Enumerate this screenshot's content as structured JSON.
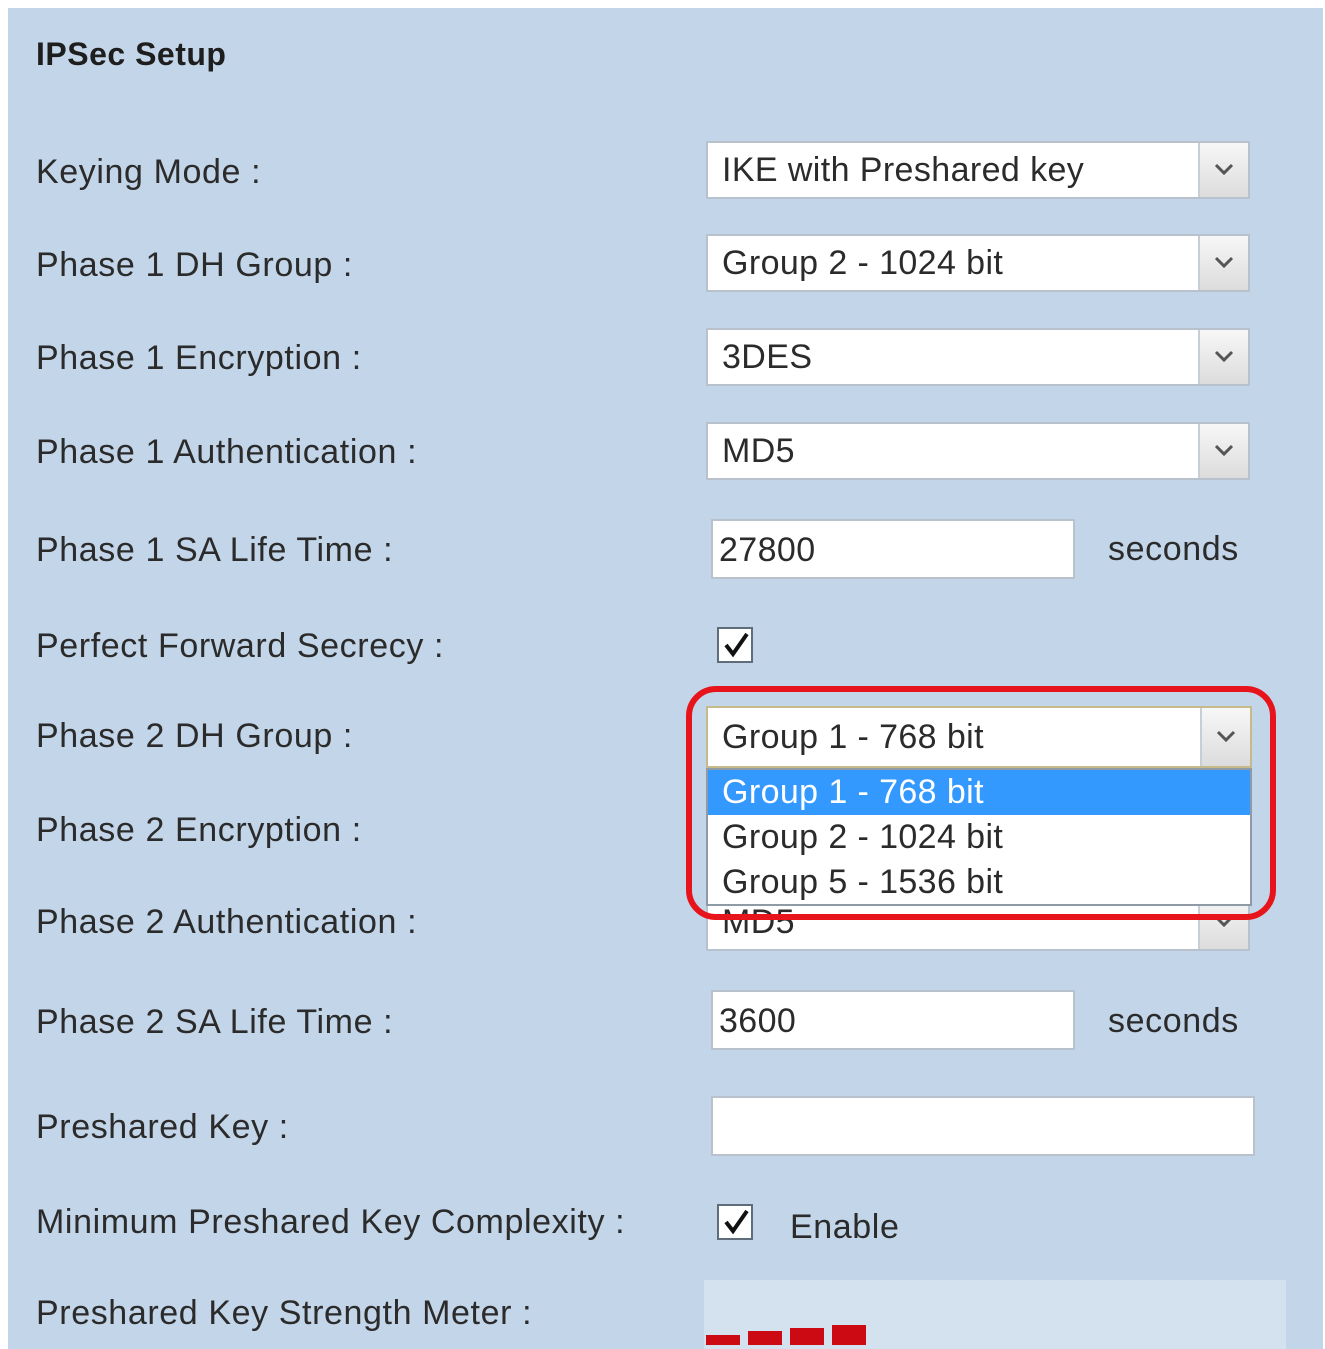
{
  "section": {
    "title": "IPSec Setup"
  },
  "fields": {
    "keying_mode": {
      "label": "Keying Mode :",
      "value": "IKE with Preshared key"
    },
    "p1_dh_group": {
      "label": "Phase 1 DH Group :",
      "value": "Group 2 - 1024 bit"
    },
    "p1_encryption": {
      "label": "Phase 1 Encryption :",
      "value": "3DES"
    },
    "p1_auth": {
      "label": "Phase 1 Authentication :",
      "value": "MD5"
    },
    "p1_sa_life": {
      "label": "Phase 1 SA Life Time :",
      "value": "27800",
      "unit": "seconds"
    },
    "pfs": {
      "label": "Perfect Forward Secrecy :",
      "checked": true
    },
    "p2_dh_group": {
      "label": "Phase 2 DH Group :",
      "value": "Group 1 - 768 bit",
      "options": [
        "Group 1 - 768 bit",
        "Group 2 - 1024 bit",
        "Group 5 - 1536 bit"
      ],
      "open": true,
      "selected_index": 0
    },
    "p2_encryption": {
      "label": "Phase 2 Encryption :"
    },
    "p2_auth": {
      "label": "Phase 2 Authentication :",
      "value": "MD5"
    },
    "p2_sa_life": {
      "label": "Phase 2 SA Life Time :",
      "value": "3600",
      "unit": "seconds"
    },
    "preshared_key": {
      "label": "Preshared Key :",
      "value": ""
    },
    "min_complexity": {
      "label": "Minimum Preshared Key Complexity :",
      "checked": true,
      "option_label": "Enable"
    },
    "strength_meter": {
      "label": "Preshared Key Strength Meter :",
      "filled_segments": 4,
      "total_segments": 4
    }
  },
  "colors": {
    "panel_bg": "#c3d5e8",
    "dropdown_selection": "#3399ff",
    "highlight_ring": "#e8141c",
    "meter_bar": "#cc0a14"
  },
  "icons": {
    "select_arrow": "chevron-down-icon",
    "checkmark": "check-icon"
  }
}
